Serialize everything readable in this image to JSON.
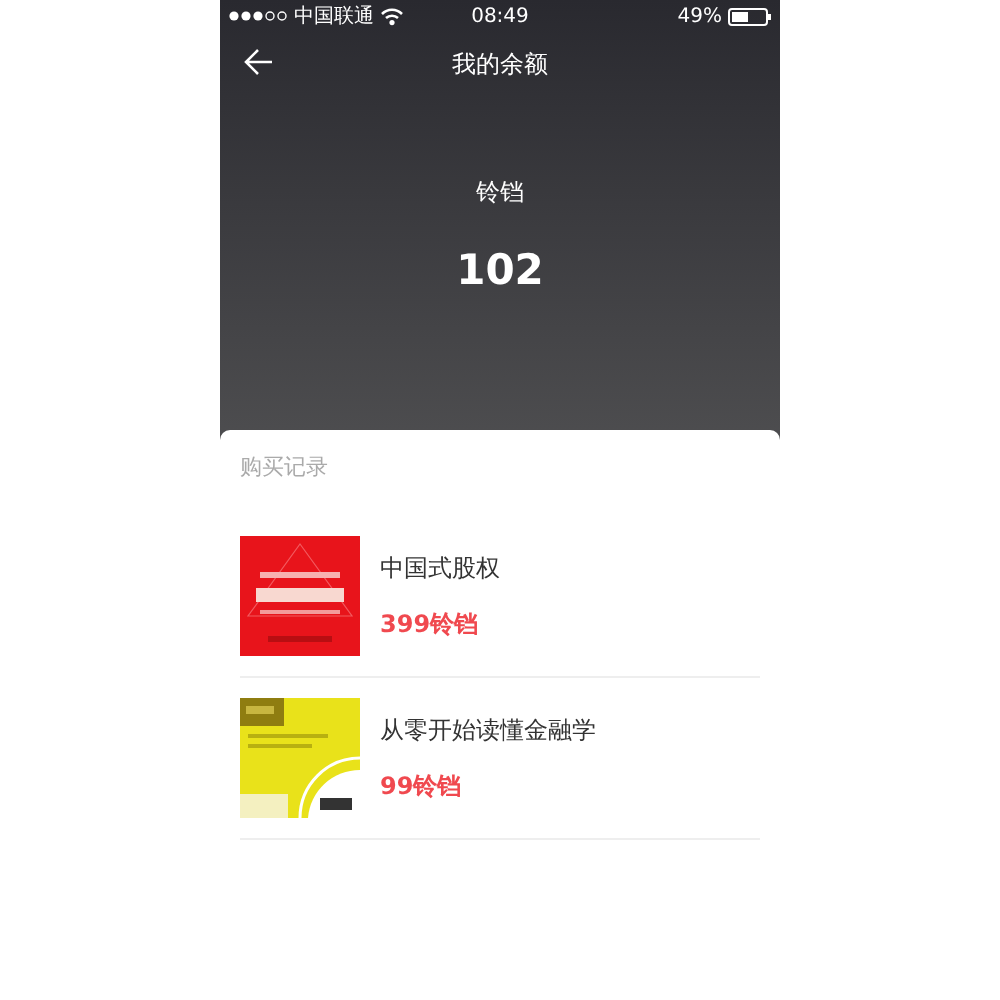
{
  "status_bar": {
    "carrier": "中国联通",
    "time": "08:49",
    "battery": "49%"
  },
  "nav": {
    "title": "我的余额"
  },
  "balance": {
    "label": "铃铛",
    "value": "102"
  },
  "records": {
    "title": "购买记录",
    "items": [
      {
        "title": "中国式股权",
        "price": "399铃铛"
      },
      {
        "title": "从零开始读懂金融学",
        "price": "99铃铛"
      }
    ]
  }
}
